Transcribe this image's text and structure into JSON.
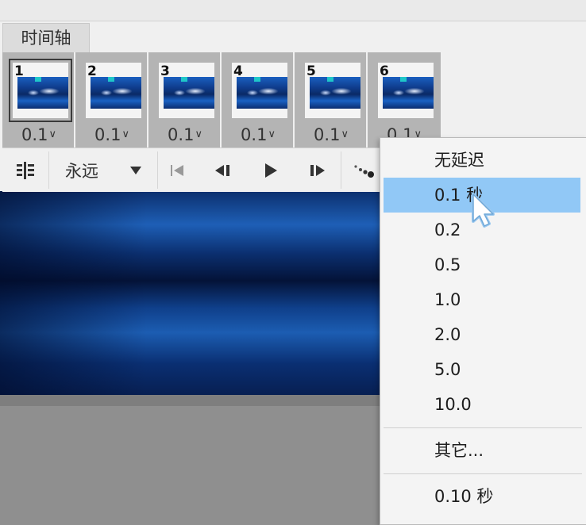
{
  "panel": {
    "tab_label": "时间轴"
  },
  "frames": [
    {
      "number": "1",
      "delay": "0.1"
    },
    {
      "number": "2",
      "delay": "0.1"
    },
    {
      "number": "3",
      "delay": "0.1"
    },
    {
      "number": "4",
      "delay": "0.1"
    },
    {
      "number": "5",
      "delay": "0.1"
    },
    {
      "number": "6",
      "delay": "0.1"
    }
  ],
  "controls": {
    "loop_label": "永远",
    "icons": [
      "timeline-convert-icon",
      "chevron-down-icon",
      "first-frame-icon",
      "previous-frame-icon",
      "play-icon",
      "next-frame-icon",
      "tween-icon"
    ]
  },
  "menu": {
    "items": [
      {
        "label": "无延迟"
      },
      {
        "label": "0.1 秒",
        "highlighted": true
      },
      {
        "label": "0.2"
      },
      {
        "label": "0.5"
      },
      {
        "label": "1.0"
      },
      {
        "label": "2.0"
      },
      {
        "label": "5.0"
      },
      {
        "label": "10.0"
      },
      {
        "label": "其它..."
      },
      {
        "label": "0.10 秒"
      }
    ]
  },
  "colors": {
    "highlight": "#91c8f6",
    "panel_bg": "#f0f0f0",
    "frame_strip_bg": "#b4b4b4"
  }
}
